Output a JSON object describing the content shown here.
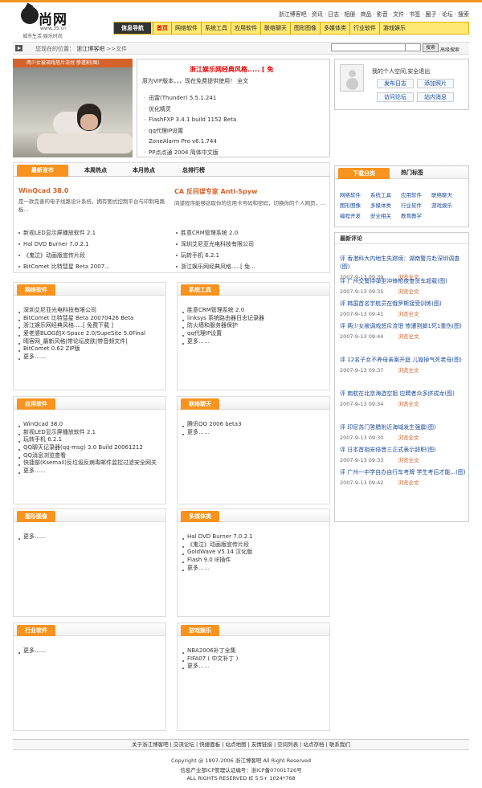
{
  "header": {
    "logo_text": "尚网",
    "logo_url": "www.35.cn",
    "logo_slogan": "城市生活 娱乐时尚",
    "toplinks": [
      "浙江博客吧",
      "资讯",
      "日志",
      "相册",
      "商品",
      "影音",
      "文件",
      "书签",
      "圈子",
      "论坛",
      "搜索"
    ]
  },
  "nav": {
    "home_label": "信息导航",
    "items": [
      "首页",
      "网络软件",
      "系统工具",
      "应用软件",
      "联络聊天",
      "图形图像",
      "多媒体类",
      "行业软件",
      "游戏娱乐"
    ]
  },
  "crumb": {
    "prefix": "您现在的位置：",
    "site": "浙江博客吧",
    "sep": ">>",
    "current": "文件",
    "search_placeholder": "",
    "select_value": "",
    "search_button": "搜索",
    "advanced": "高级搜索"
  },
  "featured": {
    "caption": "两少女被调戏怒斥流氓 惨遭割(图)",
    "thumbs": [
      "1",
      "2",
      "3",
      "4",
      "5"
    ],
    "title": "浙江娱乐网经典风格..... [ 免",
    "desc": "原为VIP版本，，，现在免费提供使用！        全文",
    "list": [
      "迅雷(Thunder) 5.5.1.241",
      "优化精灵",
      "FlashFXP 3.4.1 build 1152 Beta",
      "qq代理IP设置",
      "ZoneAlarm Pro v6.1.744",
      "PP点点通 2004 简体中文版"
    ]
  },
  "user": {
    "text": "我的个人空间,安全退出",
    "buttons": [
      "发布日志",
      "添加照片",
      "访问论坛",
      "站内消息"
    ]
  },
  "tabs": {
    "labels": [
      "最新发布",
      "本周热点",
      "本月热点",
      "总排行榜"
    ],
    "soft1_title": "WinQcad 38.0",
    "soft1_desc": "是一款完善的电子线路设计系统，拥有图式控制平台与印制电路板...",
    "soft2_title": "CA 反间谍专家 Anti-Spyw",
    "soft2_desc": "间谍程序能够窃取你的信用卡号码和密码，切换你的个人网页，...",
    "list_left": [
      "新视LED显示屏播放软件 2.1",
      "Hal DVD Burner 7.0.2.1",
      "《鬼泣》动画版宣传片段",
      "BitComet 比特彗星 Beta 2007..."
    ],
    "list_right": [
      "胜意CRM管理系统 2.0",
      "深圳艾尼亚光电科技有限公司",
      "玩转手机 6.2.1",
      "浙江娱乐网经典风格.....[ 免..."
    ]
  },
  "sidecat": {
    "tab_active": "下载分类",
    "tab_other": "热门标签",
    "items": [
      "网络软件",
      "系统工具",
      "应用软件",
      "联络聊天",
      "图形图像",
      "多媒体类",
      "行业软件",
      "游戏娱乐",
      "编程开发",
      "安全相关",
      "教育教学"
    ]
  },
  "comments": {
    "title": "最新评论",
    "more": "浏览全文",
    "items": [
      {
        "t": "评 香港科大内地生失踪续：湖南警方赴深圳调查(图)",
        "d": "2007-9-13 09:39"
      },
      {
        "t": "评 广州交警持弹型冲锋枪夜查货车超载(图)",
        "d": "2007-9-13 09:35"
      },
      {
        "t": "评 韩国首名宇航员在俄罗斯接受训练(图)",
        "d": "2007-9-13 09:41"
      },
      {
        "t": "评 两少女被调戏怒斥流氓 惨遭割脚1死1重伤(图)",
        "d": "2007-9-13 09:44"
      },
      {
        "t": "评 12名子女不养母亲案开庭 儿媳掉气死老母(图)",
        "d": "2007-9-13 09:37"
      },
      {
        "t": "评 南航在北京海选空姐 应聘者众多挤成龙(图)",
        "d": "2007-9-13 09:34"
      },
      {
        "t": "评 印尼苏门答腊附近海域发生强震(图)",
        "d": "2007-9-13 09:30"
      },
      {
        "t": "评 日本首相安倍晋三正式表示辞职(图)",
        "d": "2007-9-13 09:33"
      },
      {
        "t": "评 广州一中学自办自行车考牌 学生考后才能...(图)",
        "d": "2007-9-13 09:42"
      }
    ]
  },
  "cats": [
    {
      "title": "网络软件",
      "items": [
        "深圳艾尼亚光电科技有限公司",
        "BitComet 比特彗星 Beta 20070426 Beta",
        "浙江娱乐网经典风格.....[ 免费下载 ]",
        "爱老婆BLOG的X-Space 2.0/SupeSite 5.0Final",
        "晴客网_最新风格|带论坛皮肤|带音频文件|",
        "BitComet 0.62 ZIP版",
        "更多……"
      ]
    },
    {
      "title": "系统工具",
      "items": [
        "胜意CRM管理系统 2.0",
        "linksys 系统路由器日志记录器",
        "防火墙和服务器保护",
        "qq代理IP设置",
        "更多……"
      ]
    },
    {
      "title": "应用软件",
      "items": [
        "WinQcad 38.0",
        "新视LED显示屏播放软件 2.1",
        "玩转手机 6.2.1",
        "QQ聊天记录器(qq-msg) 3.0 Build 20061212",
        "QQ消息浏览查看",
        "快捷部(Ksemail)反垃圾反病毒邮件监控过滤安全网关",
        "更多……"
      ]
    },
    {
      "title": "联络聊天",
      "items": [
        "腾讯QQ 2006 beta3",
        "更多……"
      ]
    },
    {
      "title": "图形图像",
      "items": [
        "更多……"
      ]
    },
    {
      "title": "多媒体类",
      "items": [
        "Hal DVD Burner 7.0.2.1",
        "《鬼泣》动画版宣传片段",
        "GoldWave V5.14 汉化版",
        "Flash 9.0 IE插件",
        "更多……"
      ]
    },
    {
      "title": "行业软件",
      "items": [
        "更多……"
      ]
    },
    {
      "title": "游戏娱乐",
      "items": [
        "NBA2006补丁全集",
        "FIFA07 ( 中文补丁 )",
        "更多……"
      ]
    }
  ],
  "footer": {
    "links": "关于浙江博客吧 | 交流论坛 | 快捷面板 | 站点地图 | 友情链接 | 空间列表 | 站点存档 | 联系我们",
    "copyright": "Copyright @ 1997-2006 浙江博客吧 All Right Reserved",
    "icp": "信息产业部ICP管理认证编号：浙ICP备07001726号",
    "rights": "ALL RIGHTS RESERVED IE 5.5+ 1024*768"
  }
}
